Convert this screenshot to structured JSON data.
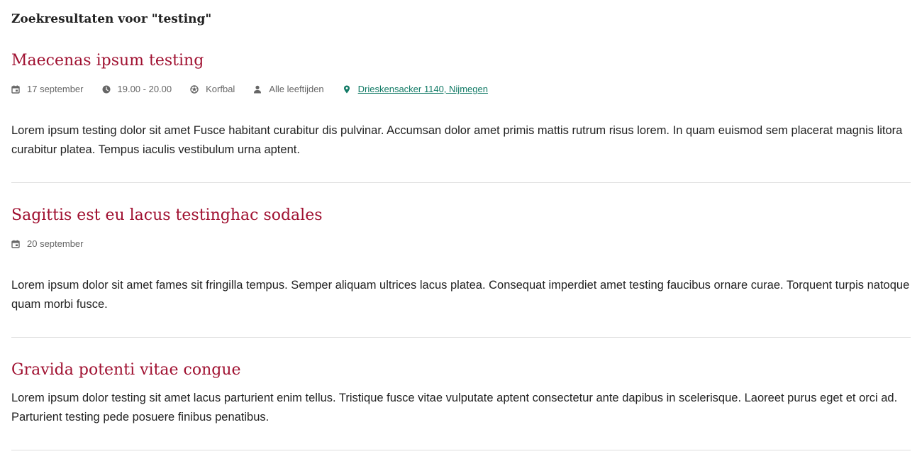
{
  "search": {
    "heading": "Zoekresultaten voor \"testing\""
  },
  "results": [
    {
      "title": "Maecenas ipsum testing",
      "date": "17 september",
      "time": "19.00 - 20.00",
      "sport": "Korfbal",
      "age": "Alle leeftijden",
      "location": "Drieskensacker 1140, Nijmegen",
      "description": "Lorem ipsum testing dolor sit amet Fusce habitant curabitur dis pulvinar. Accumsan dolor amet primis mattis rutrum risus lorem. In quam euismod sem placerat magnis litora curabitur platea. Tempus iaculis vestibulum urna aptent."
    },
    {
      "title": "Sagittis est eu lacus testinghac sodales",
      "date": "20 september",
      "description": "Lorem ipsum dolor sit amet fames sit fringilla tempus. Semper aliquam ultrices lacus platea. Consequat imperdiet amet testing faucibus ornare curae. Torquent turpis natoque quam morbi fusce."
    },
    {
      "title": "Gravida potenti vitae congue",
      "description": "Lorem ipsum dolor testing sit amet lacus parturient enim tellus. Tristique fusce vitae vulputate aptent consectetur ante dapibus in scelerisque. Laoreet purus eget et orci ad. Parturient testing pede posuere finibus penatibus."
    }
  ],
  "icons": {
    "date": "calendar-icon",
    "time": "clock-icon",
    "sport": "ball-icon",
    "age": "person-icon",
    "location": "map-pin-icon"
  },
  "colors": {
    "title": "#a01131",
    "link": "#117a65",
    "meta_text": "#666666",
    "body_text": "#222222",
    "divider": "#dddddd"
  }
}
